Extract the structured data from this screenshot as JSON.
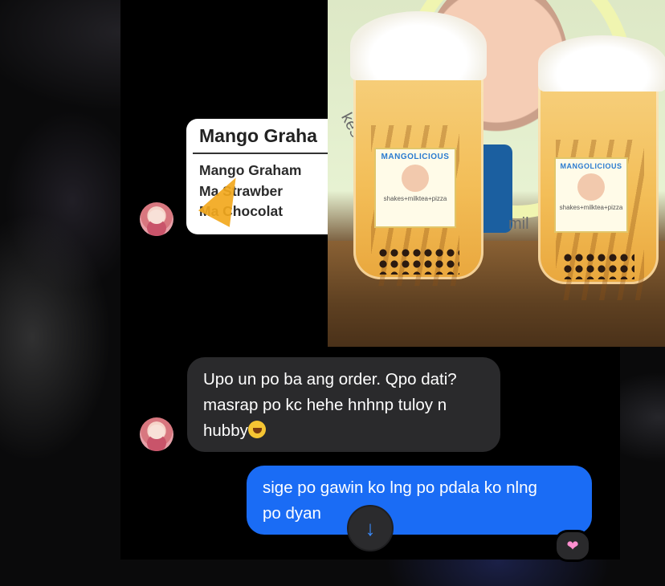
{
  "menu_card": {
    "title": "Mango Graha",
    "lines": [
      "Mango Graham",
      "Ma    Strawber",
      "Ma    Chocolat"
    ]
  },
  "photo": {
    "cup_label_brand": "MANGOLICIOUS",
    "cup_label_sub": "shakes+milktea+pizza",
    "poster_text_left": "kes-f",
    "poster_text_right": "mil"
  },
  "messages": [
    {
      "direction": "incoming",
      "text": "Upo un po ba ang order. Qpo dati?\nmasrap po kc hehe hnhnp tuloy n\nhubby",
      "emoji": "rofl-emoji"
    },
    {
      "direction": "outgoing",
      "text": "sige po gawin ko lng po pdala ko nlng\npo dyan",
      "reaction": "pink-heart"
    }
  ],
  "scroll_button_icon": "arrow-down-icon",
  "colors": {
    "incoming_bubble": "#2a2a2c",
    "outgoing_bubble": "#1a6cf5",
    "accent": "#3a8bff"
  }
}
